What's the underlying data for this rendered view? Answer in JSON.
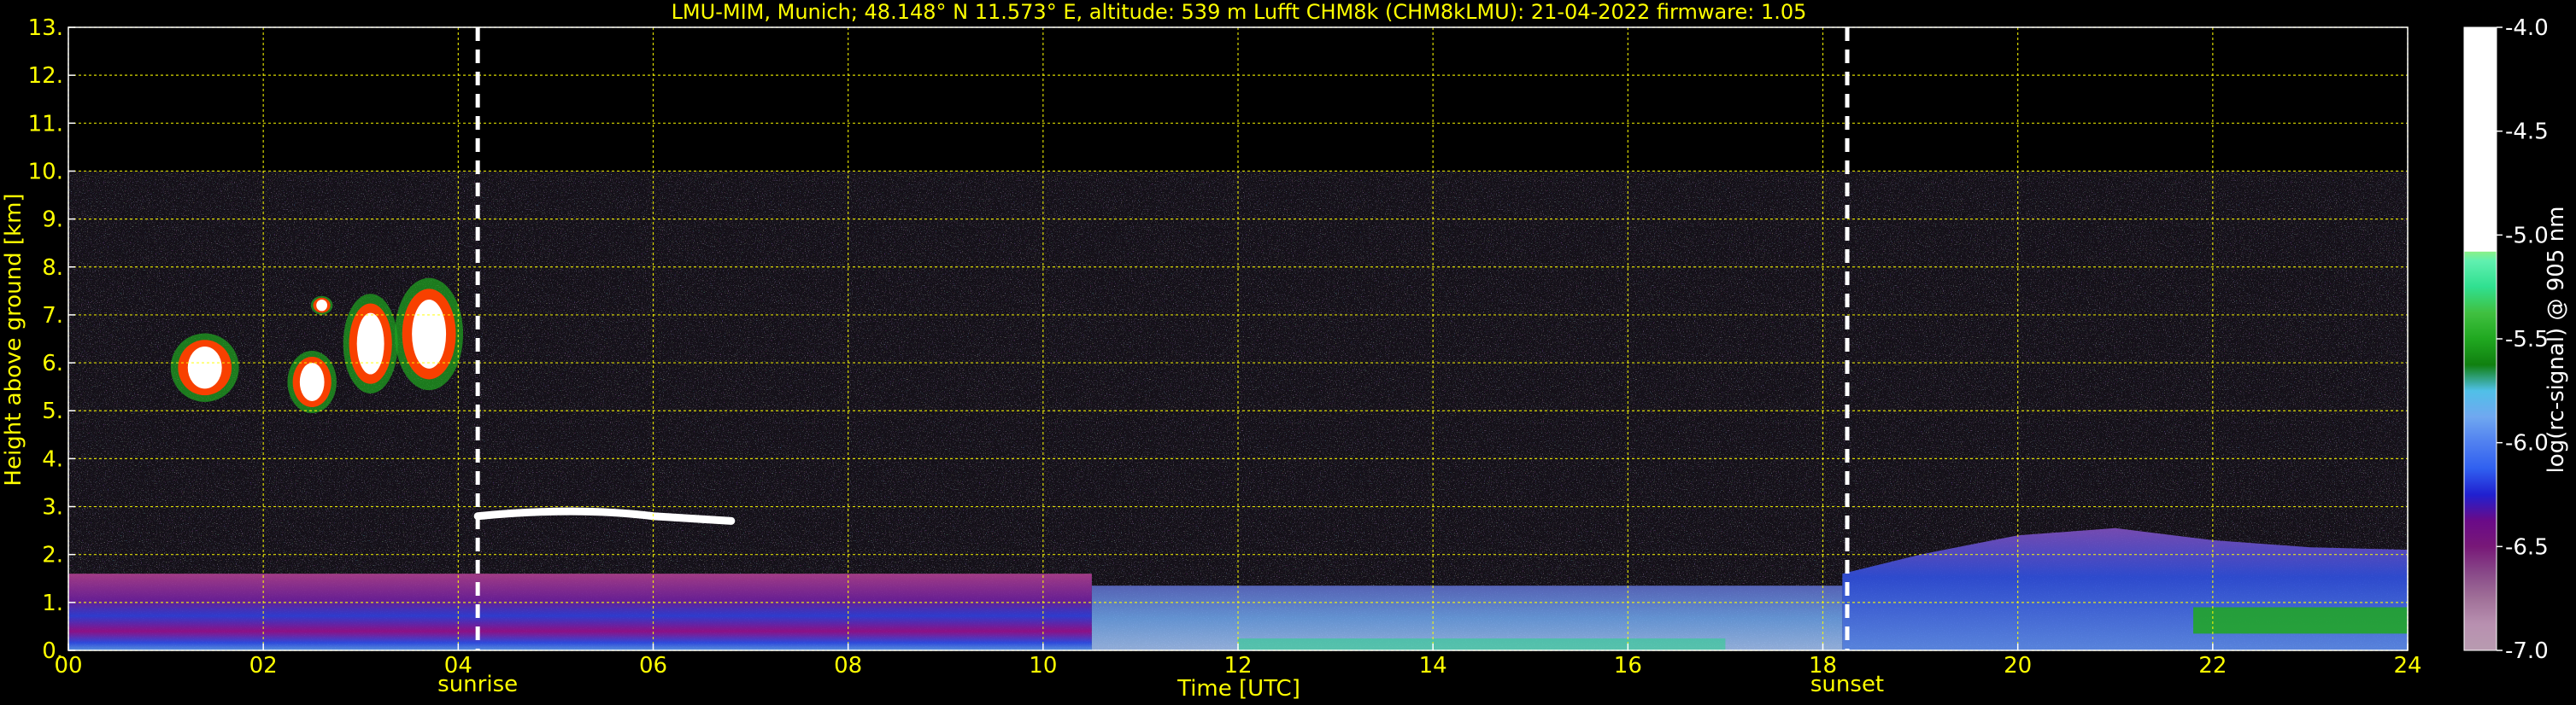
{
  "chart_data": {
    "type": "heatmap",
    "title": "LMU-MIM, Munich; 48.148° N 11.573° E, altitude: 539 m    Lufft CHM8k (CHM8kLMU): 21-04-2022    firmware: 1.05",
    "xlabel": "Time [UTC]",
    "ylabel": "Height above ground [km]",
    "xlim": [
      0,
      24
    ],
    "ylim": [
      0,
      13
    ],
    "x_ticks": [
      "00",
      "02",
      "04",
      "06",
      "08",
      "10",
      "12",
      "14",
      "16",
      "18",
      "20",
      "22",
      "24"
    ],
    "y_ticks": [
      "0.",
      "1.",
      "2.",
      "3.",
      "4.",
      "5.",
      "6.",
      "7.",
      "8.",
      "9.",
      "10.",
      "11.",
      "12.",
      "13."
    ],
    "grid": true,
    "data_top_height_km": 10,
    "markers": [
      {
        "label": "sunrise",
        "time_h": 4.2
      },
      {
        "label": "sunset",
        "time_h": 18.25
      }
    ],
    "colorbar": {
      "label": "log(rc-signal) @ 905 nm",
      "range": [
        -7.0,
        -4.0
      ],
      "ticks": [
        "-4.0",
        "-4.5",
        "-5.0",
        "-5.5",
        "-6.0",
        "-6.5",
        "-7.0"
      ],
      "colors": [
        "#b89bb0",
        "#b890b0",
        "#a07098",
        "#884888",
        "#781878",
        "#6a0a88",
        "#2020d0",
        "#3060f0",
        "#5080f0",
        "#70a8f0",
        "#50c0e8",
        "#108010",
        "#20a820",
        "#40c040",
        "#30e090",
        "#60f0b0",
        "#d8f040",
        "#f8f000",
        "#f8c000",
        "#f88000",
        "#f84000",
        "#f00000",
        "#f8a0a0",
        "#f0d0d0",
        "#ffffff"
      ]
    },
    "features": [
      {
        "name": "boundary layer",
        "start_h": 0,
        "end_h": 24,
        "top_km": 1.6
      },
      {
        "name": "residual layer",
        "start_h": 18.2,
        "end_h": 24,
        "top_km": 2.5
      },
      {
        "name": "cloud layer",
        "start_h": 4.2,
        "end_h": 6.8,
        "height_km": 2.8
      },
      {
        "name": "mid-level cloud",
        "start_h": 1.0,
        "end_h": 4.2,
        "base_km": 4.8,
        "top_km": 7.6
      }
    ]
  }
}
